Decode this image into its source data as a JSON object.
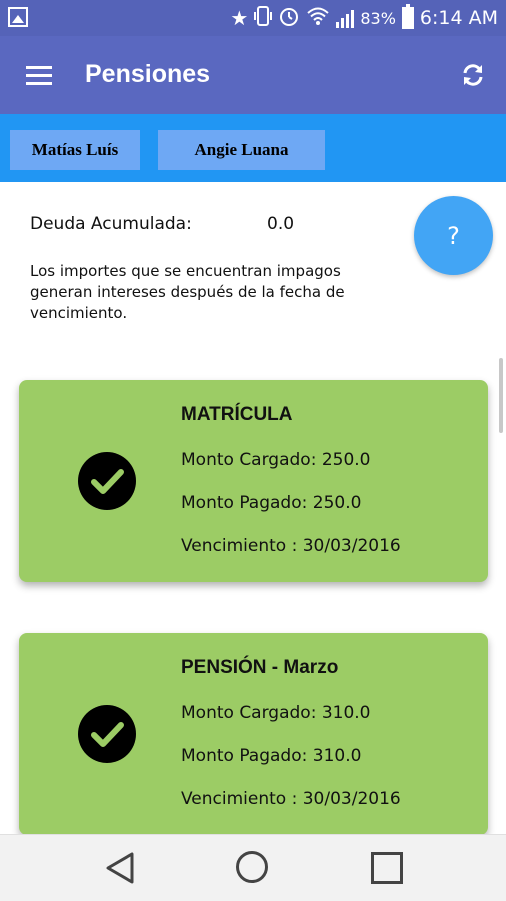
{
  "status_bar": {
    "battery": "83%",
    "time": "6:14 AM",
    "icons": [
      "gallery-icon",
      "star-icon",
      "vibrate-icon",
      "alarm-icon",
      "wifi-icon",
      "signal-icon",
      "battery-icon"
    ]
  },
  "app_bar": {
    "title": "Pensiones",
    "menu_icon": "hamburger-icon",
    "refresh_icon": "refresh-icon",
    "color": "#5a68c0"
  },
  "tabs": [
    {
      "label": "Matías Luís"
    },
    {
      "label": "Angie Luana"
    }
  ],
  "summary": {
    "debt_label": "Deuda Acumulada:",
    "debt_value": "0.0",
    "note": "Los importes que se encuentran impagos generan intereses después de la fecha de vencimiento.",
    "help_label": "?"
  },
  "cards": [
    {
      "title": "MATRÍCULA",
      "charged": "Monto Cargado: 250.0",
      "paid": "Monto Pagado: 250.0",
      "due": "Vencimiento : 30/03/2016",
      "status_icon": "check-circle-icon",
      "color": "#9ccc65"
    },
    {
      "title": "PENSIÓN - Marzo",
      "charged": "Monto Cargado: 310.0",
      "paid": "Monto Pagado: 310.0",
      "due": "Vencimiento : 30/03/2016",
      "status_icon": "check-circle-icon",
      "color": "#9ccc65"
    }
  ],
  "nav_bar": {
    "icons": [
      "back-icon",
      "home-icon",
      "recents-icon"
    ]
  }
}
